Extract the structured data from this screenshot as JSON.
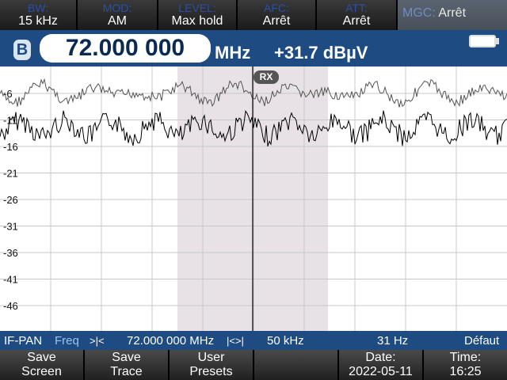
{
  "top_bar": [
    {
      "label": "BW:",
      "value": "15 kHz"
    },
    {
      "label": "MOD:",
      "value": "AM"
    },
    {
      "label": "LEVEL:",
      "value": "Max hold"
    },
    {
      "label": "AFC:",
      "value": "Arrêt"
    },
    {
      "label": "ATT:",
      "value": "Arrêt"
    }
  ],
  "mgc": {
    "label": "MGC:",
    "value": "Arrêt"
  },
  "freq_display": {
    "badge": "B",
    "frequency": "72.000 000",
    "unit": "MHz",
    "level": "+31.7 dBµV"
  },
  "plot": {
    "y_ticks": [
      "-6",
      "-11",
      "-16",
      "-21",
      "-26",
      "-31",
      "-36",
      "-41",
      "-46"
    ],
    "rx_label": "RX"
  },
  "status_bar": {
    "mode": "IF-PAN",
    "freq_label": "Freq",
    "center_freq": "72.000 000 MHz",
    "span": "50 kHz",
    "resolution": "31 Hz",
    "default_label": "Défaut"
  },
  "softkeys": [
    {
      "line1": "Save",
      "line2": "Screen"
    },
    {
      "line1": "Save",
      "line2": "Trace"
    },
    {
      "line1": "User",
      "line2": "Presets"
    },
    {
      "line1": "",
      "line2": ""
    },
    {
      "line1": "Date:",
      "line2": "2022-05-11"
    },
    {
      "line1": "Time:",
      "line2": "16:25"
    }
  ],
  "colors": {
    "accent_blue": "#1e4b82",
    "passband": "#e8e2e6",
    "trace": "#000000"
  }
}
